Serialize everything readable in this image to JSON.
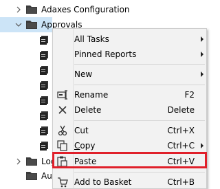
{
  "tree": {
    "items": [
      {
        "label": "Adaxes Configuration",
        "expander": "chevron-right-icon",
        "icon": "folder-icon"
      },
      {
        "label": "Approvals",
        "expander": "chevron-down-icon",
        "icon": "folder-icon"
      },
      {
        "label": "Log",
        "expander": "chevron-right-icon",
        "icon": "folder-icon"
      },
      {
        "label": "Aut",
        "icon": "folder-icon"
      }
    ],
    "child_icon": "approval-document-icon"
  },
  "context_menu": {
    "items": [
      {
        "label": "All Tasks",
        "submenu": true
      },
      {
        "label": "Pinned Reports",
        "submenu": true
      },
      {
        "label": "New",
        "submenu": true
      },
      {
        "label": "Rename",
        "shortcut": "F2",
        "icon": "rename-icon"
      },
      {
        "label": "Delete",
        "shortcut": "Delete",
        "icon": "delete-icon"
      },
      {
        "label": "Cut",
        "shortcut": "Ctrl+X",
        "icon": "cut-icon"
      },
      {
        "label": "Copy",
        "shortcut": "Ctrl+C",
        "icon": "copy-icon",
        "submenu": true
      },
      {
        "label": "Paste",
        "shortcut": "Ctrl+V",
        "icon": "paste-icon"
      },
      {
        "label": "Add to Basket",
        "shortcut": "Ctrl+B",
        "icon": "basket-icon"
      }
    ]
  },
  "colors": {
    "highlight": "#e0202a",
    "menu_background": "#f2f2f2",
    "folder": "#3a3a3a"
  }
}
